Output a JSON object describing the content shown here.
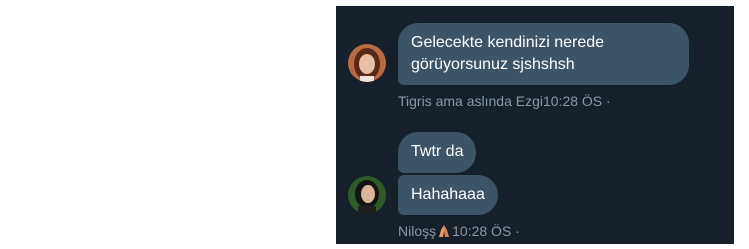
{
  "conversation": {
    "messages": [
      {
        "lines": [
          "Gelecekte kendinizi nerede",
          "görüyorsunuz sjshshsh"
        ],
        "sender": "Tigris ama aslında Ezgi",
        "time": "10:28 ÖS",
        "separator": "·"
      },
      {
        "text": "Twtr da"
      },
      {
        "text": "Hahahaaa",
        "sender": "Niloşş",
        "sender_emoji": "praying-hands-icon",
        "time": "10:28 ÖS",
        "separator": "·"
      }
    ]
  },
  "colors": {
    "background": "#15202b",
    "bubble": "#3d5466",
    "meta_text": "#8899a6"
  }
}
